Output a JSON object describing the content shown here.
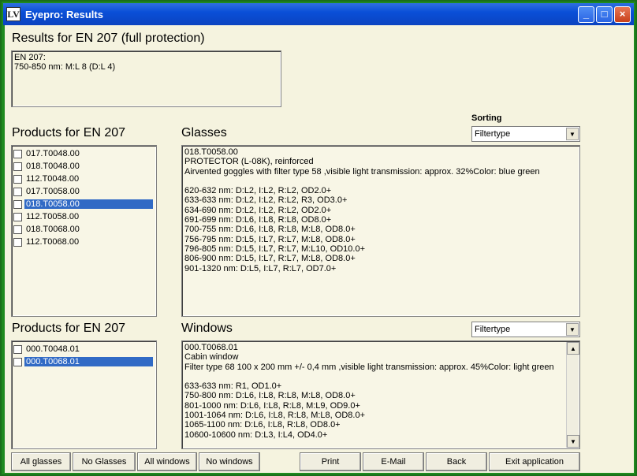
{
  "window": {
    "title": "Eyepro: Results",
    "icon": "LV"
  },
  "results": {
    "heading": "Results for EN 207 (full protection)",
    "text": "EN 207:\n750-850 nm: M:L 8 (D:L 4)"
  },
  "products_glasses": {
    "heading": "Products for EN 207",
    "items": [
      {
        "label": "017.T0048.00",
        "selected": false
      },
      {
        "label": "018.T0048.00",
        "selected": false
      },
      {
        "label": "112.T0048.00",
        "selected": false
      },
      {
        "label": "017.T0058.00",
        "selected": false
      },
      {
        "label": "018.T0058.00",
        "selected": true
      },
      {
        "label": "112.T0058.00",
        "selected": false
      },
      {
        "label": "018.T0068.00",
        "selected": false
      },
      {
        "label": "112.T0068.00",
        "selected": false
      }
    ]
  },
  "glasses": {
    "heading": "Glasses",
    "sorting_label": "Sorting",
    "sort_value": "Filtertype",
    "detail": "018.T0058.00\nPROTECTOR (L-08K), reinforced\nAirvented goggles with filter type 58 ,visible light transmission: approx. 32%Color: blue green\n\n620-632 nm: D:L2, I:L2, R:L2, OD2.0+\n633-633 nm: D:L2, I:L2, R:L2, R3, OD3.0+\n634-690 nm: D:L2, I:L2, R:L2, OD2.0+\n691-699 nm: D:L6, I:L8, R:L8, OD8.0+\n700-755 nm: D:L6, I:L8, R:L8, M:L8, OD8.0+\n756-795 nm: D:L5, I:L7, R:L7, M:L8, OD8.0+\n796-805 nm: D:L5, I:L7, R:L7, M:L10, OD10.0+\n806-900 nm: D:L5, I:L7, R:L7, M:L8, OD8.0+\n901-1320 nm: D:L5, I:L7, R:L7, OD7.0+"
  },
  "products_windows": {
    "heading": "Products for EN 207",
    "items": [
      {
        "label": "000.T0048.01",
        "selected": false
      },
      {
        "label": "000.T0068.01",
        "selected": true
      }
    ]
  },
  "windows": {
    "heading": "Windows",
    "sort_value": "Filtertype",
    "detail": "000.T0068.01\nCabin window\nFilter type 68 100 x 200 mm +/- 0,4 mm ,visible light transmission: approx. 45%Color: light green\n\n633-633 nm: R1, OD1.0+\n750-800 nm: D:L6, I:L8, R:L8, M:L8, OD8.0+\n801-1000 nm: D:L6, I:L8, R:L8, M:L9, OD9.0+\n1001-1064 nm: D:L6, I:L8, R:L8, M:L8, OD8.0+\n1065-1100 nm: D:L6, I:L8, R:L8, OD8.0+\n10600-10600 nm: D:L3, I:L4, OD4.0+"
  },
  "buttons": {
    "all_glasses": "All glasses",
    "no_glasses": "No Glasses",
    "all_windows": "All windows",
    "no_windows": "No windows",
    "print": "Print",
    "email": "E-Mail",
    "back": "Back",
    "exit": "Exit application"
  },
  "colors": {
    "selection": "#316ac5",
    "client_bg": "#f5f3df",
    "frame": "#1f8a1f"
  }
}
